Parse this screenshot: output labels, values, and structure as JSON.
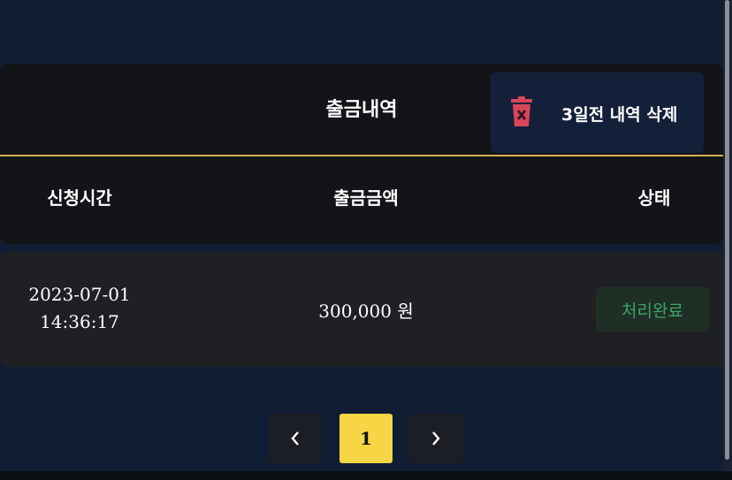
{
  "panel": {
    "title": "출금내역",
    "delete_button_label": "3일전 내역 삭제",
    "columns": [
      "신청시간",
      "출금금액",
      "상태"
    ]
  },
  "rows": [
    {
      "date": "2023-07-01",
      "time": "14:36:17",
      "amount": "300,000 원",
      "status": "처리완료"
    }
  ],
  "pagination": {
    "prev_icon": "chevron-left-icon",
    "current_page": "1",
    "next_icon": "chevron-right-icon"
  },
  "colors": {
    "background": "#111d33",
    "accent_line": "#d7b14f",
    "active_page": "#f6d645",
    "status_text": "#3fa468",
    "trash_icon": "#d9455b"
  }
}
